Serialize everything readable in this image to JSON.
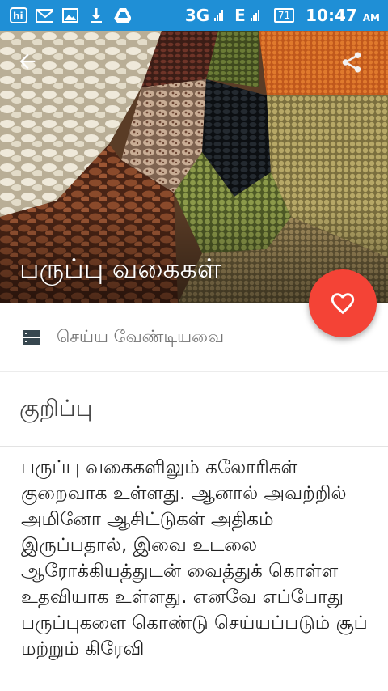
{
  "status_bar": {
    "network_3g": "3G",
    "network_e": "E",
    "battery": "71",
    "time": "10:47",
    "ampm": "AM",
    "left_icons": [
      "hike-icon",
      "gmail-icon",
      "gallery-icon",
      "download-icon",
      "drive-icon"
    ]
  },
  "header": {
    "title": "பருப்பு வகைகள்"
  },
  "todo": {
    "label": "செய்ய வேண்டியவை"
  },
  "note": {
    "title": "குறிப்பு",
    "body": "பருப்பு வகைகளிலும் கலோரிகள் குறைவாக உள்ளது. ஆனால் அவற்றில் அமினோ ஆசிட்டுகள் அதிகம் இருப்பதால், இவை உடலை ஆரோக்கியத்துடன் வைத்துக் கொள்ள உதவியாக உள்ளது. எனவே எப்போது பருப்புகளை கொண்டு செய்யப்படும் சூப் மற்றும் கிரேவி"
  },
  "colors": {
    "status_bar": "#1f8fd6",
    "fab": "#f44336"
  }
}
